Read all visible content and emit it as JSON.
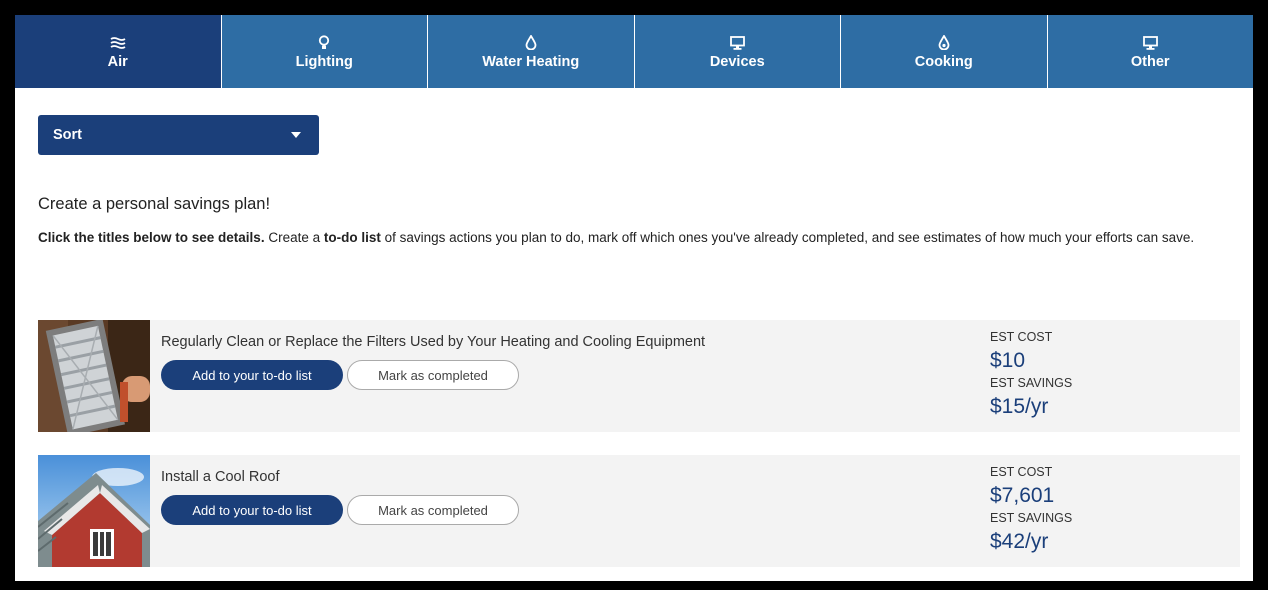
{
  "tabs": [
    {
      "label": "Air",
      "icon": "air-icon",
      "active": true
    },
    {
      "label": "Lighting",
      "icon": "lightbulb-icon",
      "active": false
    },
    {
      "label": "Water Heating",
      "icon": "water-drop-icon",
      "active": false
    },
    {
      "label": "Devices",
      "icon": "monitor-icon",
      "active": false
    },
    {
      "label": "Cooking",
      "icon": "flame-icon",
      "active": false
    },
    {
      "label": "Other",
      "icon": "monitor-icon",
      "active": false
    }
  ],
  "sort": {
    "label": "Sort"
  },
  "intro": {
    "title": "Create a personal savings plan!",
    "lead_bold": "Click the titles below to see details.",
    "text1": " Create a ",
    "todo_bold": "to-do list",
    "text2": " of savings actions you plan to do, mark off which ones you've already completed, and see estimates of how much your efforts can save."
  },
  "actions": [
    {
      "title": "Regularly Clean or Replace the Filters Used by Your Heating and Cooling Equipment",
      "add_label": "Add to your to-do list",
      "mark_label": "Mark as completed",
      "cost_label": "EST COST",
      "cost": "$10",
      "savings_label": "EST SAVINGS",
      "savings": "$15/yr",
      "image": "air-filter-photo"
    },
    {
      "title": "Install a Cool Roof",
      "add_label": "Add to your to-do list",
      "mark_label": "Mark as completed",
      "cost_label": "EST COST",
      "cost": "$7,601",
      "savings_label": "EST SAVINGS",
      "savings": "$42/yr",
      "image": "cool-roof-photo"
    }
  ],
  "colors": {
    "tab_blue": "#2e6da4",
    "tab_active": "#1b3f7a",
    "primary_button": "#1b3f7a",
    "card_bg": "#f3f3f3"
  }
}
